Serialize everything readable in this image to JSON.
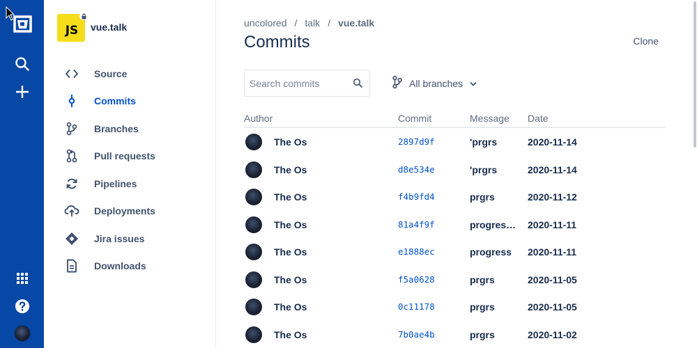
{
  "global_nav": {
    "logo_icon": "bitbucket-logo-icon",
    "search_icon": "search-icon",
    "create_icon": "plus-icon",
    "apps_icon": "app-switcher-icon",
    "help_icon": "help-icon",
    "avatar_icon": "user-avatar",
    "colors": {
      "background": "#0747a6"
    }
  },
  "repo": {
    "avatar_text": "JS",
    "name": "vue.talk",
    "avatar_color": "#f5de19"
  },
  "sidebar": {
    "items": [
      {
        "label": "Source",
        "icon": "code-icon",
        "active": false
      },
      {
        "label": "Commits",
        "icon": "commit-icon",
        "active": true
      },
      {
        "label": "Branches",
        "icon": "branch-icon",
        "active": false
      },
      {
        "label": "Pull requests",
        "icon": "pull-request-icon",
        "active": false
      },
      {
        "label": "Pipelines",
        "icon": "refresh-icon",
        "active": false
      },
      {
        "label": "Deployments",
        "icon": "cloud-upload-icon",
        "active": false
      },
      {
        "label": "Jira issues",
        "icon": "jira-icon",
        "active": false
      },
      {
        "label": "Downloads",
        "icon": "document-icon",
        "active": false
      }
    ]
  },
  "breadcrumb": {
    "items": [
      "uncolored",
      "talk",
      "vue.talk"
    ],
    "separator": "/"
  },
  "page": {
    "title": "Commits",
    "clone_label": "Clone"
  },
  "search": {
    "placeholder": "Search commits",
    "value": ""
  },
  "branch_filter": {
    "label": "All branches"
  },
  "table": {
    "headers": {
      "author": "Author",
      "commit": "Commit",
      "message": "Message",
      "date": "Date"
    },
    "rows": [
      {
        "author": "The Os",
        "commit": "2897d9f",
        "message": "'prgrs",
        "date": "2020-11-14"
      },
      {
        "author": "The Os",
        "commit": "d8e534e",
        "message": "'prgrs",
        "date": "2020-11-14"
      },
      {
        "author": "The Os",
        "commit": "f4b9fd4",
        "message": "prgrs",
        "date": "2020-11-12"
      },
      {
        "author": "The Os",
        "commit": "81a4f9f",
        "message": "progress…",
        "date": "2020-11-11"
      },
      {
        "author": "The Os",
        "commit": "e1888ec",
        "message": "progress",
        "date": "2020-11-11"
      },
      {
        "author": "The Os",
        "commit": "f5a0628",
        "message": "prgrs",
        "date": "2020-11-05"
      },
      {
        "author": "The Os",
        "commit": "0c11178",
        "message": "prgrs",
        "date": "2020-11-05"
      },
      {
        "author": "The Os",
        "commit": "7b0ae4b",
        "message": "prgrs",
        "date": "2020-11-02"
      }
    ]
  },
  "colors": {
    "accent": "#0052cc",
    "text": "#172b4d",
    "muted": "#5e6c84"
  }
}
